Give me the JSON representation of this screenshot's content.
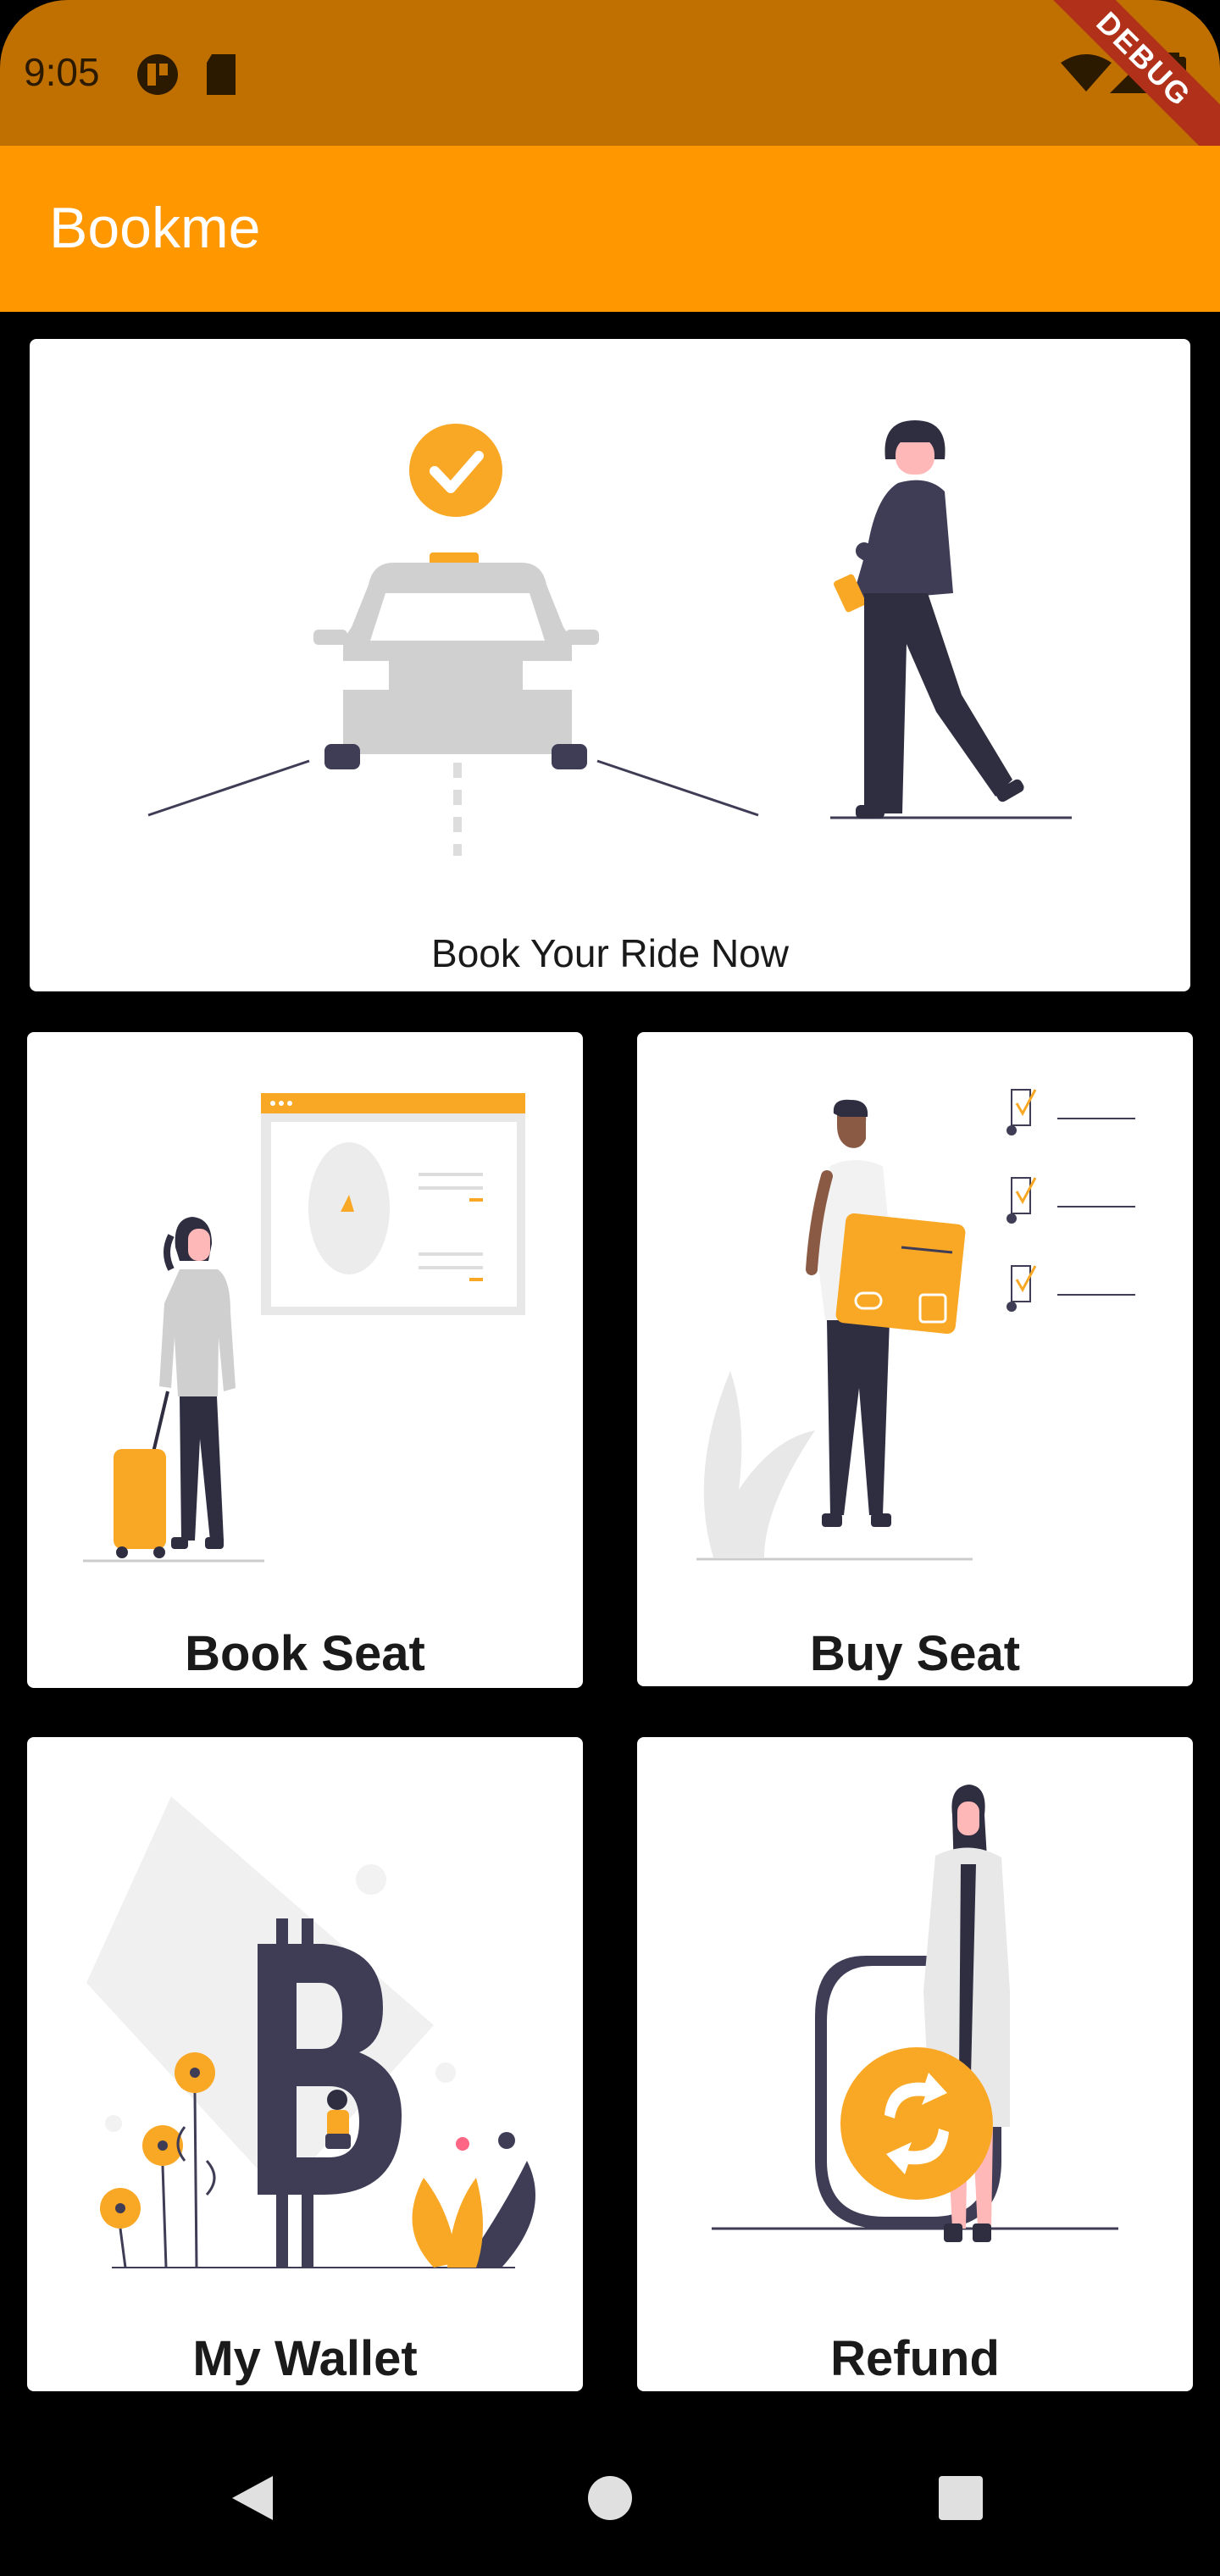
{
  "status_bar": {
    "time": "9:05",
    "icons": [
      "app-badge-icon",
      "sd-card-icon",
      "wifi-icon",
      "signal-icon",
      "battery-icon"
    ],
    "debug_banner": "DEBUG"
  },
  "app_bar": {
    "title": "Bookme",
    "color": "#ff9800"
  },
  "hero_card": {
    "label": "Book Your Ride Now"
  },
  "cards": [
    {
      "label": "Book Seat"
    },
    {
      "label": "Buy Seat"
    },
    {
      "label": "My Wallet"
    },
    {
      "label": "Refund"
    }
  ],
  "nav_bar": {
    "buttons": [
      "back-icon",
      "home-icon",
      "recents-icon"
    ]
  },
  "colors": {
    "accent": "#f9a826",
    "dark": "#3f3d56",
    "status": "#c07000"
  }
}
